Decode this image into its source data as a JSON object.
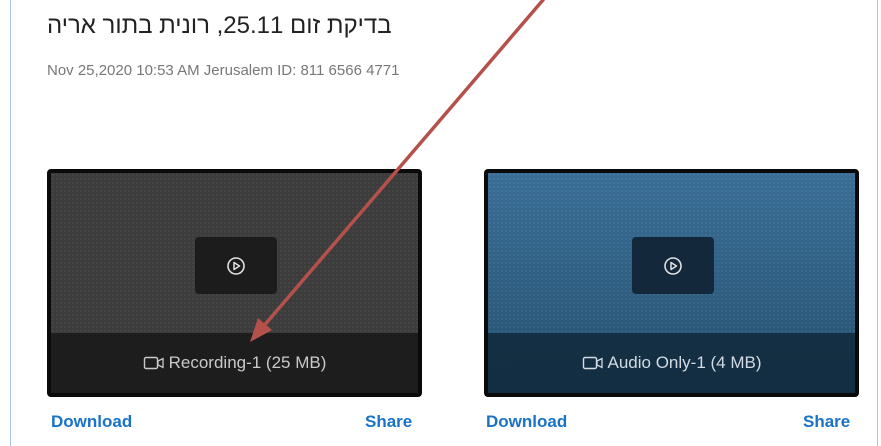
{
  "meeting": {
    "title": "בדיקת זום 25.11, רונית בתור אריה",
    "meta": "Nov 25,2020 10:53 AM Jerusalem   ID: 811 6566 4771"
  },
  "recordings": [
    {
      "label": "Recording-1 (25 MB)",
      "download_label": "Download",
      "share_label": "Share",
      "theme": "dark"
    },
    {
      "label": "Audio Only-1 (4 MB)",
      "download_label": "Download",
      "share_label": "Share",
      "theme": "blue"
    }
  ],
  "icons": {
    "play": "play-circle-icon",
    "camera": "video-camera-icon"
  },
  "colors": {
    "link": "#1a73c7",
    "annotation_arrow": "#b5514b"
  }
}
